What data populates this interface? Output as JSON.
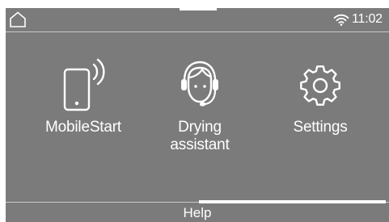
{
  "status_bar": {
    "home_icon": "home-icon",
    "wifi_icon": "wifi-icon",
    "time": "11:02"
  },
  "tiles": [
    {
      "icon": "smartphone-signal-icon",
      "label": "MobileStart"
    },
    {
      "icon": "headset-assistant-icon",
      "label": "Drying assistant"
    },
    {
      "icon": "gear-icon",
      "label": "Settings"
    }
  ],
  "footer": {
    "help_label": "Help"
  },
  "colors": {
    "screen_background": "#7b7b7b",
    "foreground": "#ffffff"
  }
}
